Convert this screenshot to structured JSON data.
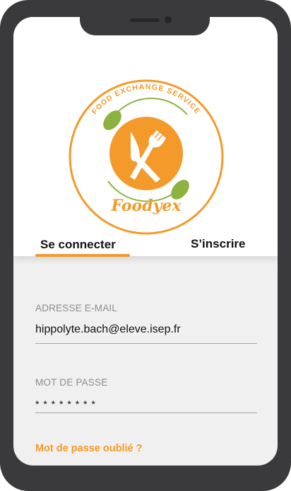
{
  "logo": {
    "arc_text": "FOOD EXCHANGE SERVICE",
    "brand_name": "Foodyex",
    "colors": {
      "orange": "#f39a2a",
      "green": "#8cb33f"
    }
  },
  "tabs": [
    {
      "label": "Se connecter",
      "active": true
    },
    {
      "label": "S’inscrire",
      "active": false
    }
  ],
  "form": {
    "email_label": "ADRESSE E-MAIL",
    "email_value": "hippolyte.bach@eleve.isep.fr",
    "password_label": "MOT DE PASSE",
    "password_value": "* * * * * * * *",
    "forgot_link": "Mot de passe oublié ?"
  },
  "colors": {
    "accent": "#f39a2a",
    "device_frame": "#3a3a3c"
  }
}
